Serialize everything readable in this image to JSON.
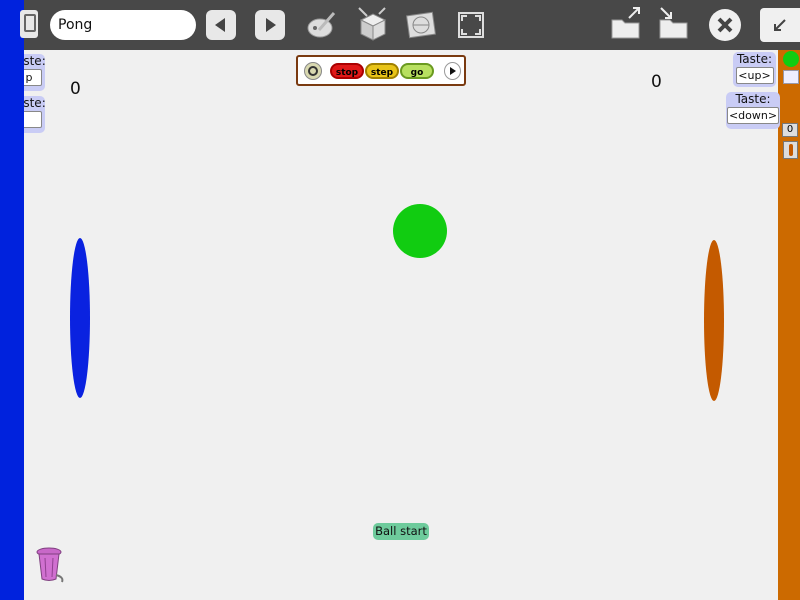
{
  "toolbar": {
    "project_name": "Pong",
    "icons": [
      "project-menu-icon",
      "back-arrow-icon",
      "forward-arrow-icon",
      "paint-icon",
      "supplies-icon",
      "world-icon",
      "fullscreen-icon",
      "load-project-icon",
      "save-project-icon",
      "close-icon",
      "shrink-icon"
    ]
  },
  "scores": {
    "left": "0",
    "right": "0"
  },
  "left_controls": {
    "up": {
      "label": "aste:",
      "value": "p"
    },
    "down": {
      "label": "aste:",
      "value": ""
    }
  },
  "right_controls": {
    "up": {
      "label": "Taste:",
      "value": "<up>"
    },
    "down": {
      "label": "Taste:",
      "value": "<down>"
    }
  },
  "script_controls": {
    "stop": "stop",
    "step": "step",
    "go": "go"
  },
  "ball_start_label": "Ball start",
  "right_strip": {
    "counter": "0"
  },
  "colors": {
    "left_paddle": "#0a22e0",
    "right_paddle": "#c45a00",
    "ball": "#11cc11",
    "toolbar": "#484848",
    "trash": "#cc66cc"
  }
}
